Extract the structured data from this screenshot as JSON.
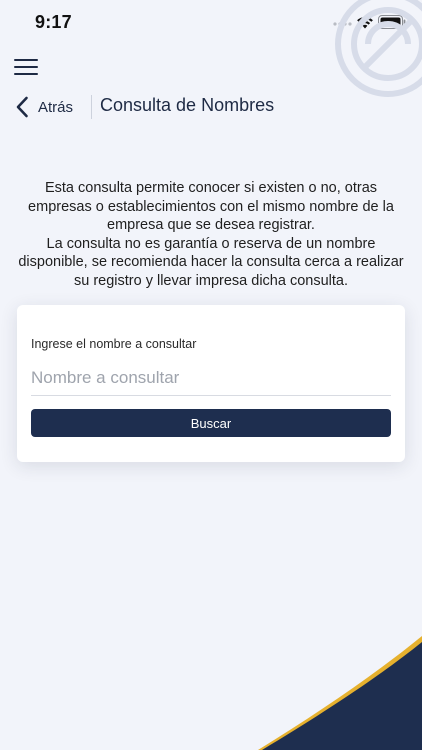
{
  "status_bar": {
    "time": "9:17"
  },
  "nav": {
    "back_label": "Atrás",
    "title": "Consulta de Nombres"
  },
  "intro": {
    "paragraph_1": "Esta consulta permite conocer si existen o no, otras empresas o establecimientos con el mismo nombre de la empresa que se desea registrar.",
    "paragraph_2": "La consulta no es garantía o reserva de un nombre disponible, se recomienda hacer la consulta cerca a realizar su registro y llevar impresa dicha consulta."
  },
  "search_form": {
    "label": "Ingrese el nombre a consultar",
    "value": "",
    "placeholder": "Nombre a consultar",
    "button_label": "Buscar"
  },
  "colors": {
    "primary": "#1e2e4f",
    "background": "#f2f4fa",
    "text": "#1e2a44",
    "accent_wave": "#1e2e4f",
    "accent_highlight": "#e6b12e"
  },
  "icons": {
    "menu": "hamburger-menu-icon",
    "back": "chevron-left-icon",
    "wifi": "wifi-icon",
    "battery": "battery-icon",
    "signal": "signal-dots-icon",
    "watermark": "watermark-logo"
  }
}
